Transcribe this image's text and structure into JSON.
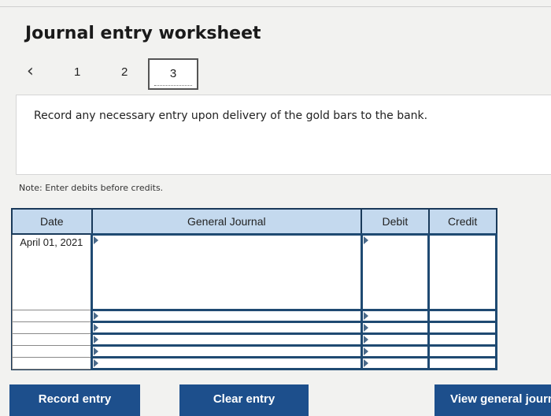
{
  "title": "Journal entry worksheet",
  "nav": {
    "prev_icon": "chevron-left-icon",
    "steps": [
      "1",
      "2",
      "3"
    ],
    "active_step": "3"
  },
  "instruction": "Record any necessary entry upon delivery of the gold bars to the bank.",
  "note": "Note: Enter debits before credits.",
  "table": {
    "headers": {
      "date": "Date",
      "journal": "General Journal",
      "debit": "Debit",
      "credit": "Credit"
    },
    "rows": [
      {
        "date": "April 01, 2021",
        "journal": "",
        "debit": "",
        "credit": ""
      },
      {
        "date": "",
        "journal": "",
        "debit": "",
        "credit": ""
      },
      {
        "date": "",
        "journal": "",
        "debit": "",
        "credit": ""
      },
      {
        "date": "",
        "journal": "",
        "debit": "",
        "credit": ""
      },
      {
        "date": "",
        "journal": "",
        "debit": "",
        "credit": ""
      },
      {
        "date": "",
        "journal": "",
        "debit": "",
        "credit": ""
      }
    ]
  },
  "buttons": {
    "record": "Record entry",
    "clear": "Clear entry",
    "view": "View general journa"
  },
  "colors": {
    "button": "#1d4f8c",
    "header": "#c4d9ee",
    "grid": "#1f4a72"
  }
}
